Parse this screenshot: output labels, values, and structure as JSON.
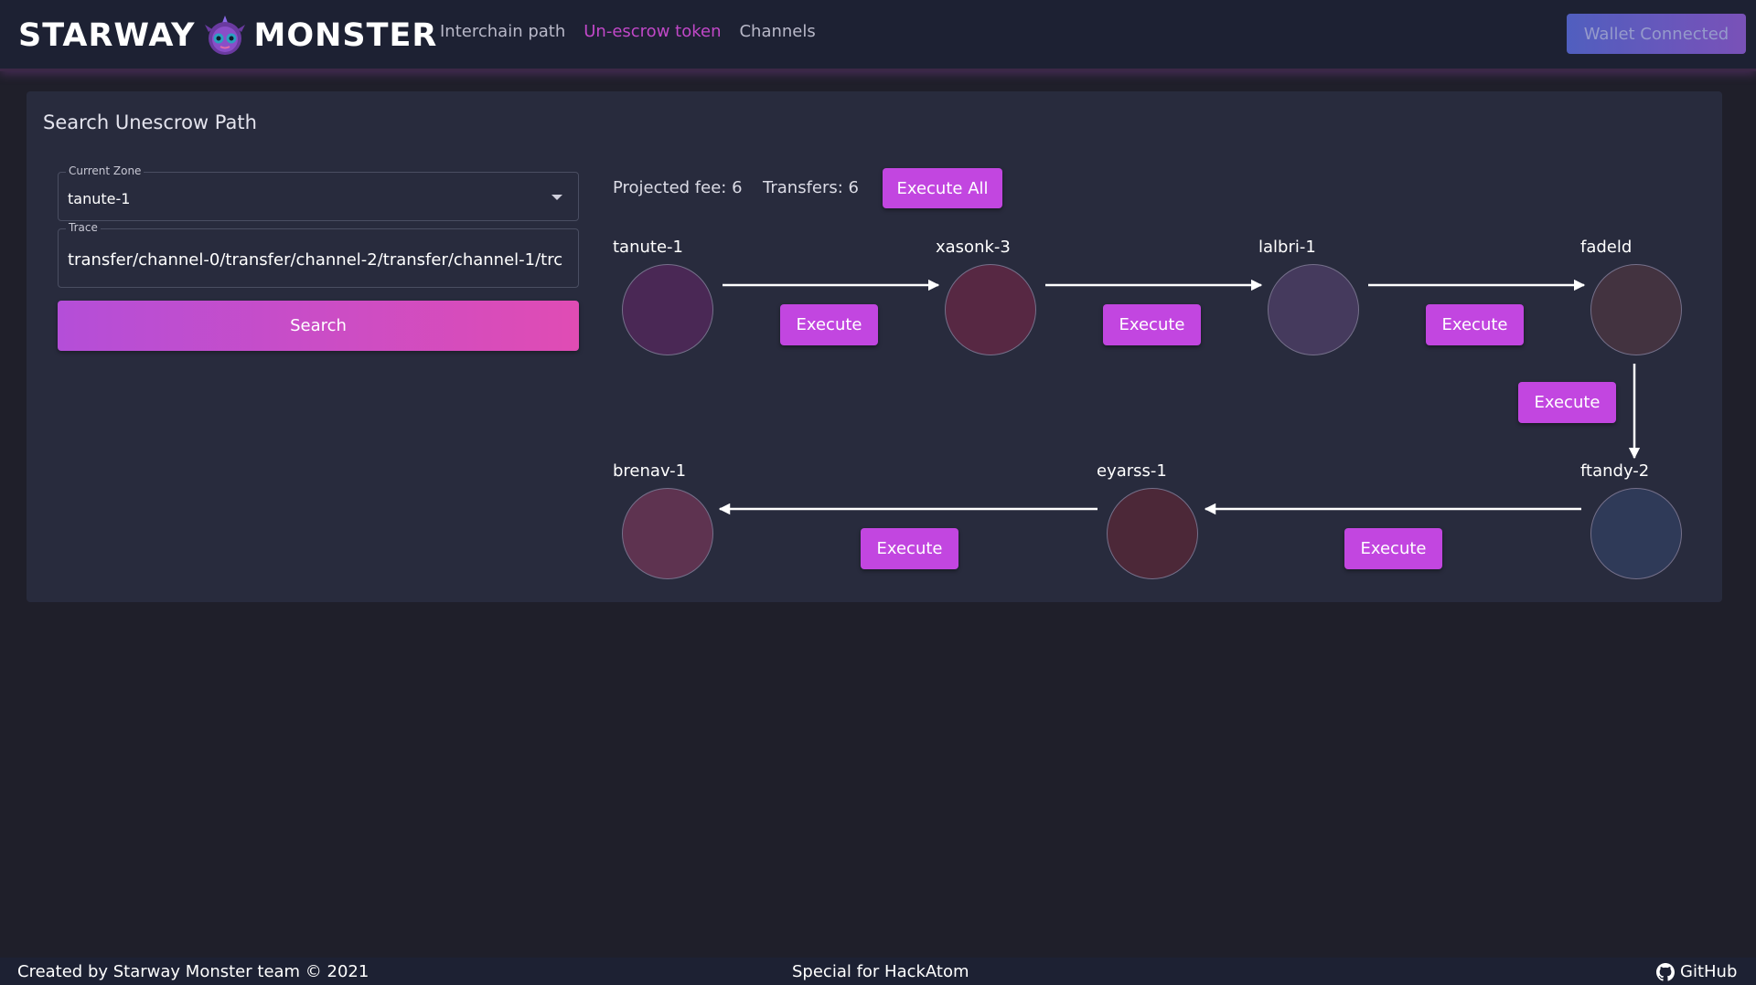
{
  "header": {
    "logo_left": "STARWAY",
    "logo_right": "MONSTER",
    "nav": [
      {
        "label": "Interchain path",
        "active": false
      },
      {
        "label": "Un-escrow token",
        "active": true
      },
      {
        "label": "Channels",
        "active": false
      }
    ],
    "wallet_label": "Wallet Connected"
  },
  "panel": {
    "title": "Search Unescrow Path",
    "zone": {
      "label": "Current Zone",
      "value": "tanute-1"
    },
    "trace": {
      "label": "Trace",
      "value": "transfer/channel-0/transfer/channel-2/transfer/channel-1/trc"
    },
    "search_label": "Search"
  },
  "path": {
    "projected_fee": "Projected fee: 6",
    "transfers": "Transfers: 6",
    "execute_all_label": "Execute All",
    "execute_label": "Execute",
    "nodes": [
      {
        "name": "tanute-1",
        "color": "#4a2855"
      },
      {
        "name": "xasonk-3",
        "color": "#572843"
      },
      {
        "name": "lalbri-1",
        "color": "#453a5d"
      },
      {
        "name": "fadeld",
        "color": "#433340"
      },
      {
        "name": "ftandy-2",
        "color": "#2f3a58"
      },
      {
        "name": "eyarss-1",
        "color": "#4c2838"
      },
      {
        "name": "brenav-1",
        "color": "#5e3350"
      }
    ]
  },
  "footer": {
    "credit": "Created by Starway Monster team © 2021",
    "special": "Special for HackAtom",
    "github": "GitHub"
  },
  "colors": {
    "accent": "#c246e0",
    "active_nav": "#c148c8",
    "background": "#1f1f2a",
    "panel": "#282b3d"
  },
  "icons": {
    "mascot": "monster-mascot-icon",
    "dropdown": "chevron-down-icon",
    "github": "github-icon"
  }
}
